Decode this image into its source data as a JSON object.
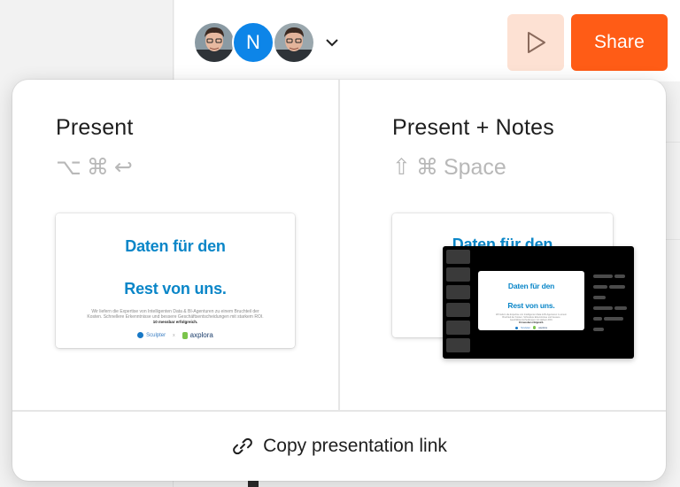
{
  "header": {
    "avatars": [
      {
        "kind": "photo",
        "name": "avatar-photo-1"
      },
      {
        "kind": "initial",
        "initial": "N",
        "color": "#0d85e8"
      },
      {
        "kind": "photo",
        "name": "avatar-photo-2"
      }
    ],
    "share_label": "Share",
    "play_icon": "play-icon",
    "dropdown_icon": "chevron-down-icon",
    "accent": "#ff5c16",
    "play_bg": "#fde1d3"
  },
  "popover": {
    "present": {
      "title": "Present",
      "shortcut": [
        "⌥",
        "⌘",
        "↩"
      ]
    },
    "present_notes": {
      "title": "Present + Notes",
      "shortcut_keys": [
        "⇧",
        "⌘"
      ],
      "shortcut_word": "Space"
    },
    "slide": {
      "title_line1": "Daten für den",
      "title_line2": "Rest von uns.",
      "body": "Wir liefern die Expertise von Intelligenten Data & BI-Agenturen zu einem Bruchteil der Kosten. Schnellere Erkenntnisse und bessere Geschäftsentscheidungen mit starkem ROI.",
      "bold_line": "10 messbar erfolgreich.",
      "logo1": "Sculpter",
      "logo_sep": "x",
      "logo2": "axplora",
      "title_color": "#0a86c8"
    },
    "copy_link": {
      "label": "Copy presentation link",
      "icon": "link-icon"
    }
  }
}
